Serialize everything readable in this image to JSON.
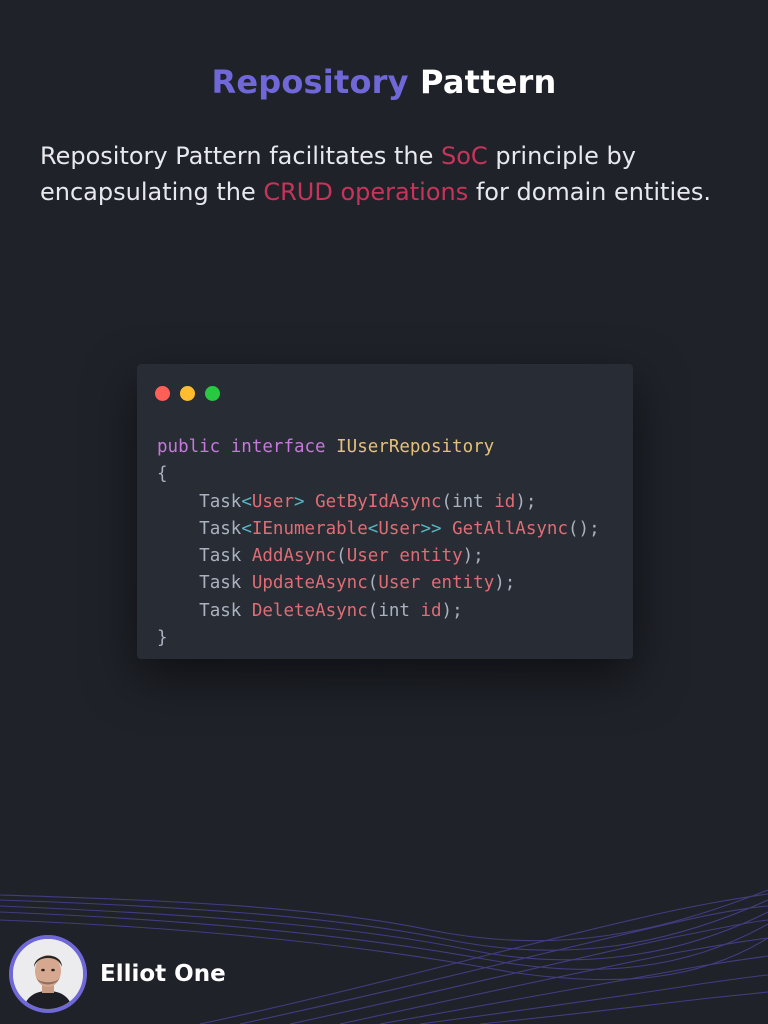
{
  "title": {
    "accent": "Repository",
    "rest": "Pattern"
  },
  "description": {
    "part1": "Repository Pattern facilitates the ",
    "highlight1": "SoC",
    "part2": " principle by encapsulating the ",
    "highlight2": "CRUD operations",
    "part3": " for domain entities."
  },
  "code_window": {
    "lines": {
      "l1_kw1": "public",
      "l1_kw2": "interface",
      "l1_name": "IUserRepository",
      "l2": "{",
      "l3_task": "Task",
      "l3_open": "<",
      "l3_generic": "User",
      "l3_close": ">",
      "l3_method": "GetByIdAsync",
      "l3_open_paren": "(",
      "l3_param_type": "int",
      "l3_param": "id",
      "l3_end": ");",
      "l4_task": "Task",
      "l4_open": "<",
      "l4_generic1": "IEnumerable",
      "l4_open2": "<",
      "l4_generic2": "User",
      "l4_close": ">>",
      "l4_method": "GetAllAsync",
      "l4_end": "();",
      "l5_task": "Task",
      "l5_method": "AddAsync",
      "l5_open_paren": "(",
      "l5_param_type": "User",
      "l5_param": "entity",
      "l5_end": ");",
      "l6_task": "Task",
      "l6_method": "UpdateAsync",
      "l6_open_paren": "(",
      "l6_param_type": "User",
      "l6_param": "entity",
      "l6_end": ");",
      "l7_task": "Task",
      "l7_method": "DeleteAsync",
      "l7_open_paren": "(",
      "l7_param_type": "int",
      "l7_param": "id",
      "l7_end": ");",
      "l8": "}"
    }
  },
  "author": {
    "name": "Elliot One"
  },
  "colors": {
    "background": "#1f2229",
    "accent": "#7068d8",
    "highlight": "#c7345a",
    "code_bg": "#282c34"
  }
}
